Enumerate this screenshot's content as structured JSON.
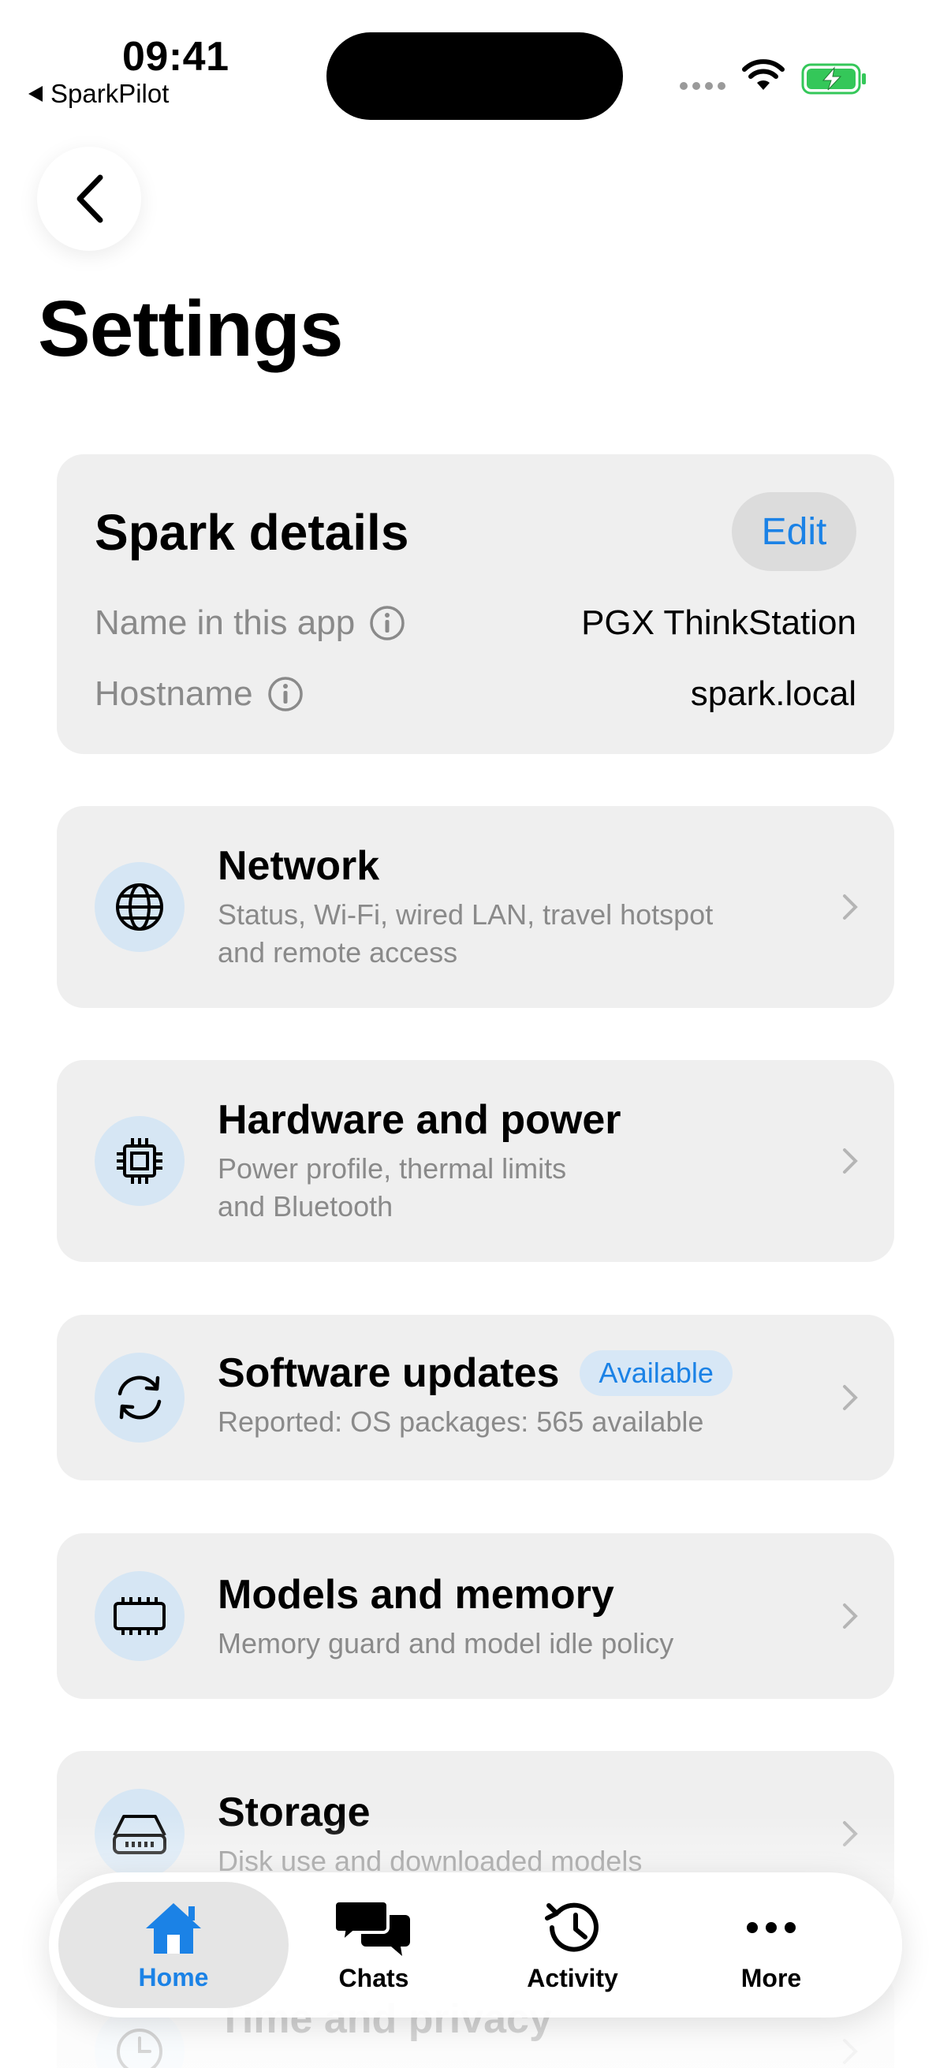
{
  "status_bar": {
    "time": "09:41",
    "back_app": "SparkPilot",
    "battery_color": "#34c759"
  },
  "page": {
    "title": "Settings",
    "back_icon": "chevron-left-icon"
  },
  "spark_details": {
    "title": "Spark details",
    "edit_label": "Edit",
    "rows": [
      {
        "label": "Name in this app",
        "value": "PGX ThinkStation"
      },
      {
        "label": "Hostname",
        "value": "spark.local"
      }
    ]
  },
  "settings_items": [
    {
      "title": "Network",
      "subtitle_line1": "Status, Wi-Fi, wired LAN, travel hotspot",
      "subtitle_line2": "and remote access",
      "icon": "globe-icon"
    },
    {
      "title": "Hardware and power",
      "subtitle_line1": "Power profile, thermal limits",
      "subtitle_line2": "and Bluetooth",
      "icon": "chip-icon"
    },
    {
      "title": "Software updates",
      "badge": "Available",
      "subtitle_line1": "Reported: OS packages: 565 available",
      "icon": "refresh-icon"
    },
    {
      "title": "Models and memory",
      "subtitle_line1": "Memory guard and model idle policy",
      "icon": "memory-icon"
    },
    {
      "title": "Storage",
      "subtitle_line1": "Disk use and downloaded models",
      "icon": "drive-icon"
    },
    {
      "title": "Time and privacy",
      "icon": "clock-icon"
    }
  ],
  "tabbar": {
    "tabs": [
      {
        "label": "Home",
        "icon": "house-icon",
        "active": true
      },
      {
        "label": "Chats",
        "icon": "chat-bubbles-icon",
        "active": false
      },
      {
        "label": "Activity",
        "icon": "history-icon",
        "active": false
      },
      {
        "label": "More",
        "icon": "ellipsis-icon",
        "active": false
      }
    ]
  },
  "colors": {
    "accent": "#1b82e6",
    "card_bg": "#efefef",
    "icon_bg": "#d6e6f4",
    "secondary_text": "#8a8a8a"
  }
}
